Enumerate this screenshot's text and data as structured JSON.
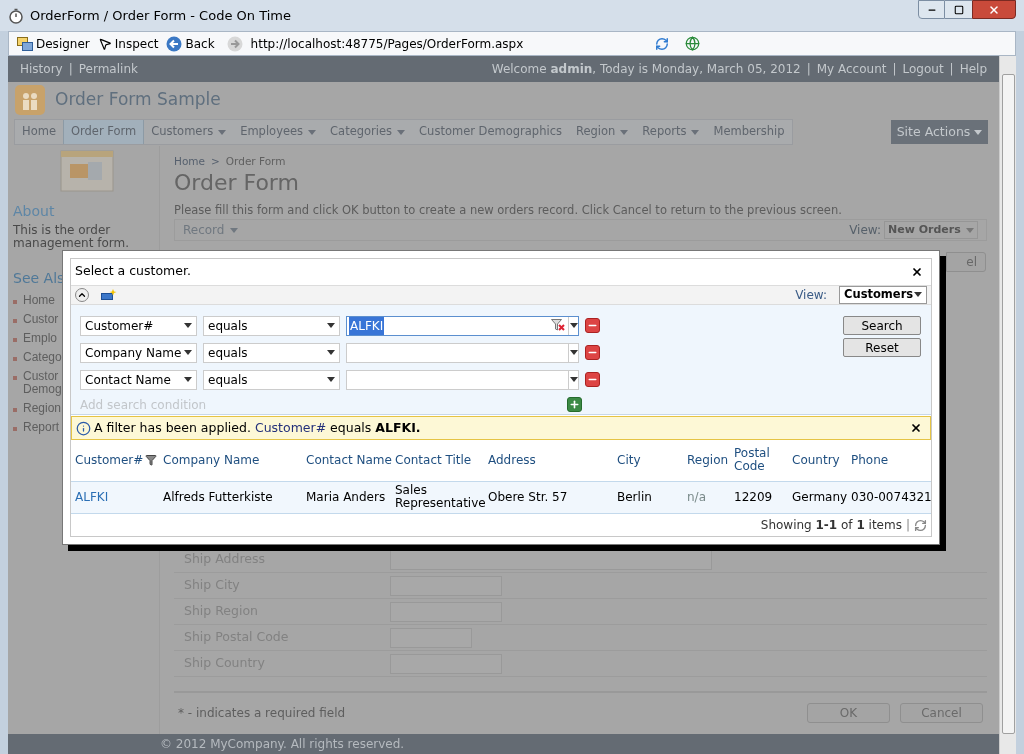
{
  "window": {
    "title": "OrderForm / Order Form - Code On Time"
  },
  "browser_toolbar": {
    "buttons": [
      {
        "label": "Designer",
        "kind": "designer"
      },
      {
        "label": "Inspect",
        "kind": "inspect"
      },
      {
        "label": "Back",
        "kind": "back"
      }
    ],
    "address": "http://localhost:48775/Pages/OrderForm.aspx"
  },
  "top_bar": {
    "left": [
      {
        "text": "History",
        "kind": "link"
      },
      {
        "text": "|",
        "kind": "separator"
      },
      {
        "text": "Permalink",
        "kind": "link"
      }
    ],
    "right": [
      {
        "text": "Welcome **admin**, Today is Monday, March 05, 2012",
        "kind": "text"
      },
      {
        "text": "|",
        "kind": "separator"
      },
      {
        "text": "My Account",
        "kind": "link"
      },
      {
        "text": "|",
        "kind": "separator"
      },
      {
        "text": "Logout",
        "kind": "link"
      },
      {
        "text": "|",
        "kind": "separator"
      },
      {
        "text": "Help",
        "kind": "link"
      }
    ]
  },
  "site": {
    "title": "Order Form Sample"
  },
  "menu": [
    {
      "label": "Home",
      "selected": false,
      "dropdown": false
    },
    {
      "label": "Order Form",
      "selected": true,
      "dropdown": false
    },
    {
      "label": "Customers",
      "selected": false,
      "dropdown": true
    },
    {
      "label": "Employees",
      "selected": false,
      "dropdown": true
    },
    {
      "label": "Categories",
      "selected": false,
      "dropdown": true
    },
    {
      "label": "Customer Demographics",
      "selected": false,
      "dropdown": false
    },
    {
      "label": "Region",
      "selected": false,
      "dropdown": true
    },
    {
      "label": "Reports",
      "selected": false,
      "dropdown": true
    },
    {
      "label": "Membership",
      "selected": false,
      "dropdown": false
    }
  ],
  "site_actions": "Site Actions",
  "sidebar": {
    "about_title": "About",
    "about_text": "This is the order management form.",
    "see_also_title": "See Als",
    "items": [
      "Home",
      "Custor",
      "Emplo",
      "Catego",
      "Custor Demog",
      "Region",
      "Report"
    ]
  },
  "main": {
    "breadcrumb": [
      {
        "text": "Home",
        "kind": "link"
      },
      {
        "text": ">",
        "kind": "separator"
      },
      {
        "text": "Order Form",
        "kind": "current"
      }
    ],
    "title": "Order Form",
    "description": "Please fill this form and click OK button to create a new orders record. Click Cancel to return to the previous screen.",
    "toolbar": {
      "action": "Record",
      "view_label": "View:",
      "view": "New Orders"
    },
    "partial_button": "el",
    "fields": [
      {
        "label": "Ship Address",
        "kind": "long"
      },
      {
        "label": "Ship City",
        "kind": "medium"
      },
      {
        "label": "Ship Region",
        "kind": "medium"
      },
      {
        "label": "Ship Postal Code",
        "kind": "short"
      },
      {
        "label": "Ship Country",
        "kind": "medium"
      }
    ],
    "required_note": "* - indicates a required field",
    "buttons": [
      "OK",
      "Cancel"
    ]
  },
  "footer": "© 2012 MyCompany. All rights reserved.",
  "dialog": {
    "title": "Select a customer.",
    "view_label": "View:",
    "view": "Customers",
    "conditions": [
      {
        "field": "Customer#",
        "operator": "equals",
        "value": "ALFKI",
        "text_selected": true
      },
      {
        "field": "Company Name",
        "operator": "equals",
        "text_selected": false
      },
      {
        "field": "Contact Name",
        "operator": "equals",
        "text_selected": false
      }
    ],
    "add_condition": "Add search condition",
    "buttons": [
      "Search",
      "Reset"
    ],
    "filter": {
      "prefix": "A filter has been applied.",
      "field": "Customer#",
      "operator": "equals",
      "value": "ALFKI."
    },
    "columns": [
      {
        "label": "Customer#",
        "filtered": true
      },
      {
        "label": "Company Name",
        "filtered": false
      },
      {
        "label": "Contact Name",
        "filtered": false
      },
      {
        "label": "Contact Title",
        "filtered": false
      },
      {
        "label": "Address",
        "filtered": false
      },
      {
        "label": "City",
        "filtered": false
      },
      {
        "label": "Region",
        "filtered": false
      },
      {
        "label": "Postal Code",
        "filtered": false
      },
      {
        "label": "Country",
        "filtered": false
      },
      {
        "label": "Phone",
        "filtered": false
      }
    ],
    "rows": [
      {
        "cells": [
          {
            "text": "ALFKI",
            "kind": "link"
          },
          {
            "text": "Alfreds Futterkiste",
            "kind": "plain"
          },
          {
            "text": "Maria Anders",
            "kind": "plain"
          },
          {
            "text": "Sales Representative",
            "kind": "plain"
          },
          {
            "text": "Obere Str. 57",
            "kind": "plain"
          },
          {
            "text": "Berlin",
            "kind": "plain"
          },
          {
            "text": "n/a",
            "kind": "empty"
          },
          {
            "text": "12209",
            "kind": "plain"
          },
          {
            "text": "Germany",
            "kind": "plain"
          },
          {
            "text": "030-0074321",
            "kind": "plain"
          }
        ]
      }
    ],
    "pager": "Showing **1-1** of **1** items",
    "pager_separator": "|"
  }
}
